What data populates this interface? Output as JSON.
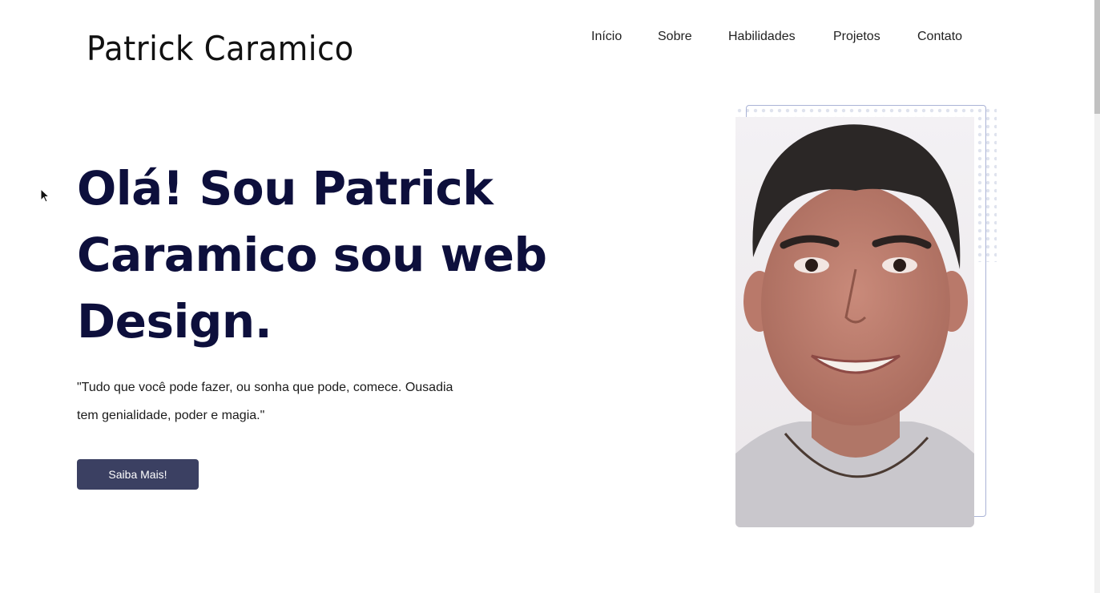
{
  "header": {
    "logo_text": "Patrick Caramico",
    "nav": [
      {
        "label": "Início"
      },
      {
        "label": "Sobre"
      },
      {
        "label": "Habilidades"
      },
      {
        "label": "Projetos"
      },
      {
        "label": "Contato"
      }
    ]
  },
  "hero": {
    "title_line1": "Olá! Sou Patrick",
    "title_line2": "Caramico sou web",
    "title_line3": "Design.",
    "quote_line1": "\"Tudo que você pode fazer, ou sonha que pode, comece. Ousadia",
    "quote_line2": "tem genialidade, poder e magia.\"",
    "cta_label": "Saiba Mais!"
  },
  "colors": {
    "heading": "#0d0f3c",
    "button_bg": "#3b4062",
    "frame_border": "#aab3d6"
  },
  "icons": {
    "cursor": "mouse-pointer-icon"
  }
}
